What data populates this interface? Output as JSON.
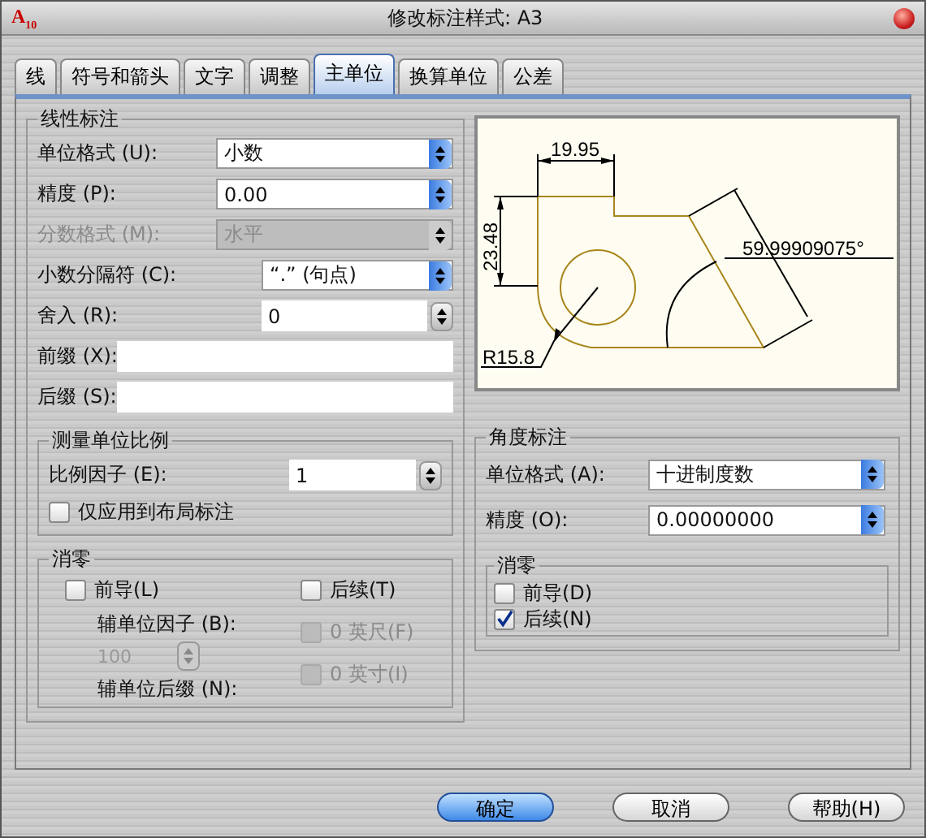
{
  "window": {
    "title": "修改标注样式: A3",
    "logo_letter": "A",
    "logo_version": "10"
  },
  "tabs": [
    {
      "label": "线",
      "selected": false
    },
    {
      "label": "符号和箭头",
      "selected": false
    },
    {
      "label": "文字",
      "selected": false
    },
    {
      "label": "调整",
      "selected": false
    },
    {
      "label": "主单位",
      "selected": true
    },
    {
      "label": "换算单位",
      "selected": false
    },
    {
      "label": "公差",
      "selected": false
    }
  ],
  "linear": {
    "title": "线性标注",
    "fields": [
      {
        "kind": "select",
        "label": "单位格式 (U):",
        "value": "小数",
        "disabled": false
      },
      {
        "kind": "select",
        "label": "精度 (P):",
        "value": "0.00",
        "disabled": false
      },
      {
        "kind": "select",
        "label": "分数格式 (M):",
        "value": "水平",
        "disabled": true
      },
      {
        "kind": "select",
        "label": "小数分隔符 (C):",
        "value": "“.”  (句点)",
        "disabled": false
      },
      {
        "kind": "spin",
        "label": "舍入 (R):",
        "value": "0"
      },
      {
        "kind": "text",
        "label": "前缀 (X):"
      },
      {
        "kind": "text",
        "label": "后缀 (S):"
      }
    ]
  },
  "scale": {
    "title": "测量单位比例",
    "factor_label": "比例因子 (E):",
    "factor_value": "1",
    "layout_only": {
      "label": "仅应用到布局标注",
      "checked": false
    }
  },
  "zeros": {
    "title": "消零",
    "leading": {
      "label": "前导(L)",
      "checked": false
    },
    "sub_factor_label": "辅单位因子 (B):",
    "sub_factor_value": "100",
    "sub_suffix_label": "辅单位后缀 (N):",
    "trailing": {
      "label": "后续(T)",
      "checked": false
    },
    "feet": {
      "label": "0 英尺(F)",
      "checked": false,
      "disabled": true
    },
    "inches": {
      "label": "0 英寸(I)",
      "checked": false,
      "disabled": true
    }
  },
  "preview": {
    "width_dim": "19.95",
    "height_dim": "23.48",
    "radius_dim": "R15.8",
    "angle_dim": "59.99909075°"
  },
  "angular": {
    "title": "角度标注",
    "fields": [
      {
        "label": "单位格式 (A):",
        "value": "十进制度数"
      },
      {
        "label": "精度 (O):",
        "value": "0.00000000"
      }
    ],
    "zeros": {
      "title": "消零",
      "options": [
        {
          "label": "前导(D)",
          "checked": false
        },
        {
          "label": "后续(N)",
          "checked": true
        }
      ]
    }
  },
  "buttons": [
    {
      "label": "确定",
      "kind": "primary"
    },
    {
      "label": "取消",
      "kind": "normal"
    },
    {
      "label": "帮助(H)",
      "kind": "normal"
    }
  ]
}
